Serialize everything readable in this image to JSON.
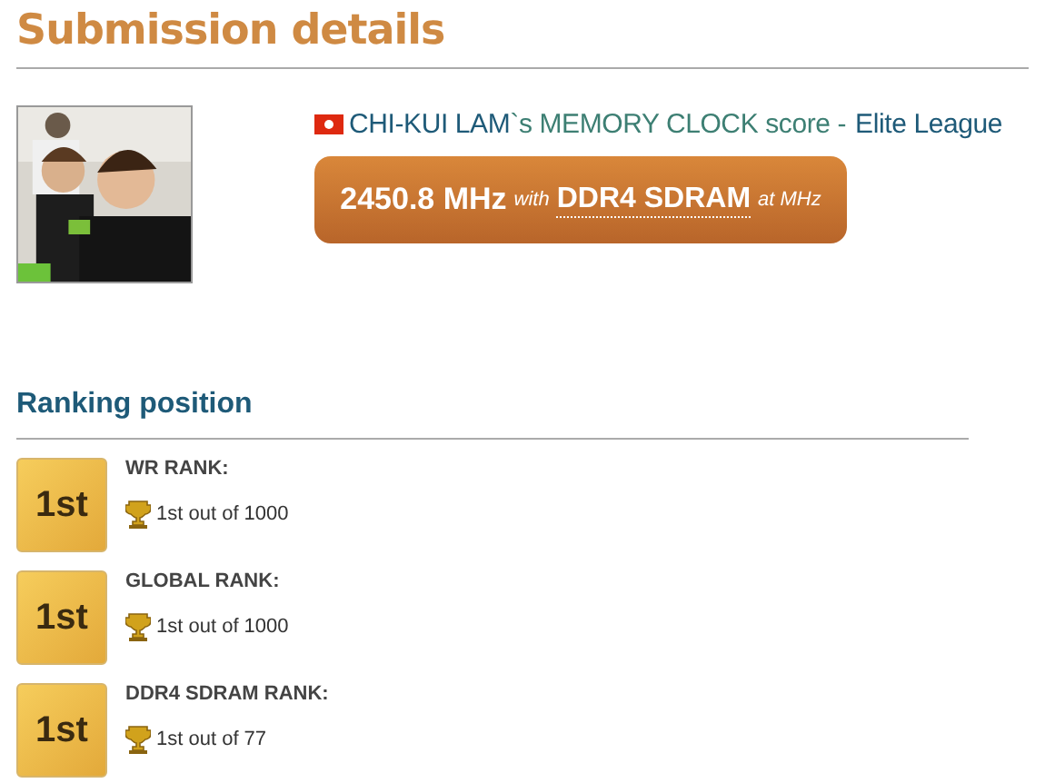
{
  "page_title": "Submission details",
  "submission": {
    "user": "CHI-KUI LAM",
    "middle": "`s MEMORY CLOCK score -",
    "league": "Elite League",
    "score": "2450.8 MHz",
    "with": "with",
    "hardware": "DDR4 SDRAM",
    "at": "at MHz"
  },
  "ranking": {
    "title": "Ranking position",
    "ranks": [
      {
        "badge": "1st",
        "label": "WR RANK:",
        "detail": "1st out of 1000"
      },
      {
        "badge": "1st",
        "label": "GLOBAL RANK:",
        "detail": "1st out of 1000"
      },
      {
        "badge": "1st",
        "label": "DDR4 SDRAM RANK:",
        "detail": "1st out of 77"
      }
    ]
  }
}
